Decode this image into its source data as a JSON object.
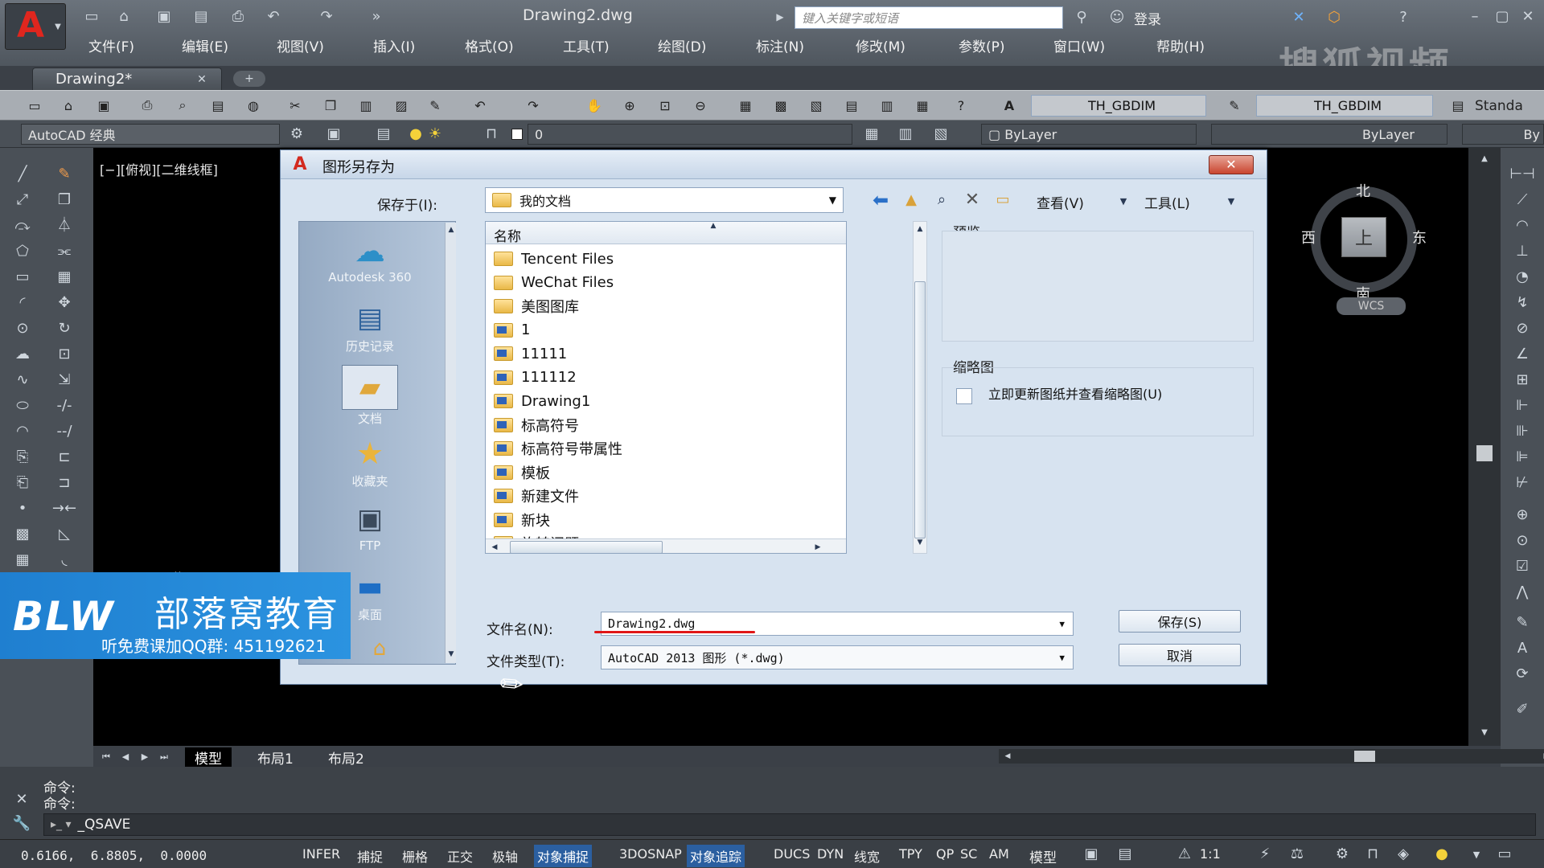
{
  "title_bar": {
    "filename": "Drawing2.dwg",
    "search_placeholder": "键入关键字或短语",
    "login": "登录"
  },
  "menu": [
    "文件(F)",
    "编辑(E)",
    "视图(V)",
    "插入(I)",
    "格式(O)",
    "工具(T)",
    "绘图(D)",
    "标注(N)",
    "修改(M)",
    "参数(P)",
    "窗口(W)",
    "帮助(H)"
  ],
  "doc_tab": "Drawing2*",
  "watermark_sohu": "搜狐视频",
  "toolbar": {
    "dimstyle1": "TH_GBDIM",
    "dimstyle2": "TH_GBDIM",
    "standard": "Standa",
    "workspace": "AutoCAD 经典",
    "layer": "0",
    "color": "ByLayer",
    "linetype": "ByLayer",
    "lineweight": "By"
  },
  "viewport_label": "[−][俯视][二维线框]",
  "viewcube": {
    "north": "北",
    "south": "南",
    "east": "东",
    "west": "西",
    "top": "上",
    "wcs": "WCS"
  },
  "dialog": {
    "title": "图形另存为",
    "save_in_label": "保存于(I):",
    "save_in_value": "我的文档",
    "view_menu": "查看(V)",
    "tools_menu": "工具(L)",
    "column_name": "名称",
    "preview_label": "预览",
    "thumbnail_label": "缩略图",
    "thumbnail_checkbox": "立即更新图纸并查看缩略图(U)",
    "filename_label": "文件名(N):",
    "filename_value": "Drawing2.dwg",
    "filetype_label": "文件类型(T):",
    "filetype_value": "AutoCAD 2013 图形 (*.dwg)",
    "save_button": "保存(S)",
    "cancel_button": "取消",
    "places": [
      {
        "label": "Autodesk 360",
        "icon": "cloud-icon"
      },
      {
        "label": "历史记录",
        "icon": "history-icon"
      },
      {
        "label": "文档",
        "icon": "documents-icon"
      },
      {
        "label": "收藏夹",
        "icon": "favorites-icon"
      },
      {
        "label": "FTP",
        "icon": "ftp-icon"
      },
      {
        "label": "桌面",
        "icon": "desktop-icon"
      }
    ],
    "files": [
      {
        "name": "Tencent Files",
        "type": "folder"
      },
      {
        "name": "WeChat Files",
        "type": "folder"
      },
      {
        "name": "美图图库",
        "type": "folder"
      },
      {
        "name": "1",
        "type": "dwg-folder"
      },
      {
        "name": "11111",
        "type": "dwg-folder"
      },
      {
        "name": "111112",
        "type": "dwg-folder"
      },
      {
        "name": "Drawing1",
        "type": "dwg-folder"
      },
      {
        "name": "标高符号",
        "type": "dwg-folder"
      },
      {
        "name": "标高符号带属性",
        "type": "dwg-folder"
      },
      {
        "name": "模板",
        "type": "dwg-folder"
      },
      {
        "name": "新建文件",
        "type": "dwg-folder"
      },
      {
        "name": "新块",
        "type": "dwg-folder"
      },
      {
        "name": "旋转问题",
        "type": "dwg-folder"
      }
    ]
  },
  "watermark_blw": {
    "logo": "BLW",
    "name": "部落窝教育",
    "qq": "听免费课加QQ群: 451192621"
  },
  "layout_tabs": [
    "模型",
    "布局1",
    "布局2"
  ],
  "command": {
    "line1": "命令:",
    "line2": "命令:",
    "input": "_QSAVE"
  },
  "status": {
    "coords": "0.6166,  6.8805,  0.0000",
    "toggles": [
      {
        "label": "INFER",
        "on": false
      },
      {
        "label": "捕捉",
        "on": false
      },
      {
        "label": "栅格",
        "on": false
      },
      {
        "label": "正交",
        "on": false
      },
      {
        "label": "极轴",
        "on": false
      },
      {
        "label": "对象捕捉",
        "on": true
      },
      {
        "label": "3DOSNAP",
        "on": false
      },
      {
        "label": "对象追踪",
        "on": true
      },
      {
        "label": "DUCS",
        "on": false
      },
      {
        "label": "DYN",
        "on": false
      },
      {
        "label": "线宽",
        "on": false
      },
      {
        "label": "TPY",
        "on": false
      },
      {
        "label": "QP",
        "on": false
      },
      {
        "label": "SC",
        "on": false
      },
      {
        "label": "AM",
        "on": false
      }
    ],
    "model": "模型",
    "scale": "1:1"
  }
}
